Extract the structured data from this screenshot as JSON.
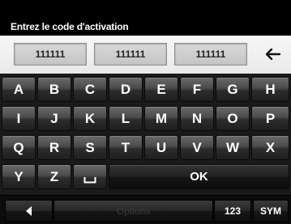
{
  "header": {
    "title": "Entrez le code d'activation"
  },
  "code_fields": [
    "111111",
    "111111",
    "111111"
  ],
  "backspace_icon": "backspace-arrow-icon",
  "keyboard": {
    "row1": [
      "A",
      "B",
      "C",
      "D",
      "E",
      "F",
      "G",
      "H"
    ],
    "row2": [
      "I",
      "J",
      "K",
      "L",
      "M",
      "N",
      "O",
      "P"
    ],
    "row3": [
      "Q",
      "R",
      "S",
      "T",
      "U",
      "V",
      "W",
      "X"
    ],
    "row4": [
      "Y",
      "Z"
    ],
    "space_icon": "space-bar-icon",
    "ok_label": "OK"
  },
  "bottom_bar": {
    "back_icon": "triangle-left-icon",
    "options_label": "Options",
    "numeric_label": "123",
    "sym_label": "SYM"
  },
  "colors": {
    "background": "#000000",
    "code_strip": "#eeeeee",
    "key_text": "#ffffff",
    "disabled_text": "#3c3c3c"
  }
}
